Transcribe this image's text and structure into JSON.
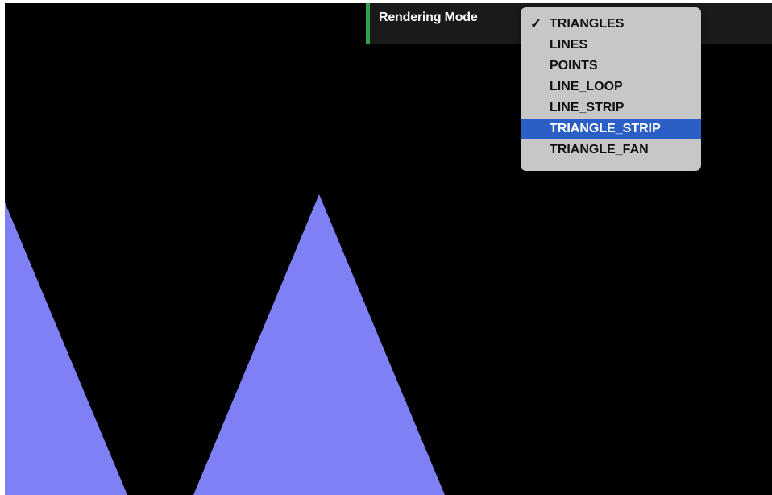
{
  "gui": {
    "label": "Rendering Mode",
    "accent_color": "#2fa34d"
  },
  "dropdown": {
    "selected": "TRIANGLES",
    "highlighted": "TRIANGLE_STRIP",
    "check_icon": "checkmark-icon",
    "check_glyph": "✓",
    "options": [
      "TRIANGLES",
      "LINES",
      "POINTS",
      "LINE_LOOP",
      "LINE_STRIP",
      "TRIANGLE_STRIP",
      "TRIANGLE_FAN"
    ]
  },
  "scene": {
    "background_color": "#000000",
    "fill_color": "#8080f5"
  }
}
